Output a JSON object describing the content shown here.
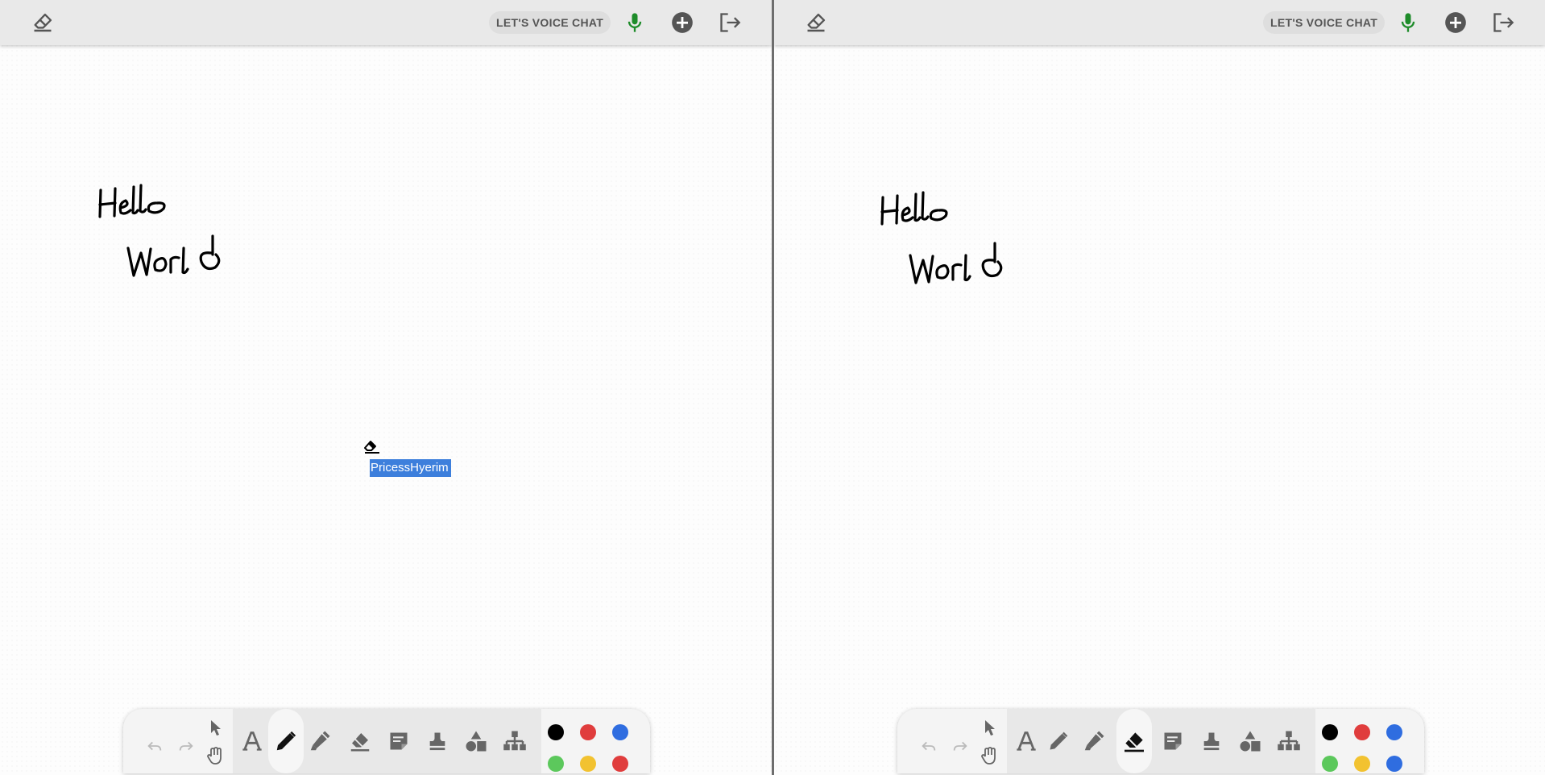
{
  "topbar": {
    "voice_chat_label": "LET'S VOICE CHAT",
    "icons": [
      "eraser-icon",
      "microphone-icon",
      "add-circle-icon",
      "logout-icon"
    ]
  },
  "colors": {
    "mic": "#1e8c2a",
    "selection": "#3d7fdc",
    "palette": [
      "#000000",
      "#e03d3d",
      "#2f6de0",
      "#5cc85c",
      "#f2c230",
      "#e03d3d",
      "#000000",
      "#e03d3d",
      "#2f6de0",
      "#5cc85c",
      "#f2c230",
      "#2f6de0"
    ]
  },
  "canvas": {
    "handwriting_line1": "Hello",
    "handwriting_line2": "World",
    "cursor_user_label": "PricessHyerim"
  },
  "toolbar": {
    "tools": [
      "undo-icon",
      "redo-icon",
      "select-pointer-icon",
      "hand-pan-icon",
      "text-icon",
      "pen-icon",
      "highlighter-icon",
      "eraser-icon",
      "sticky-note-icon",
      "stamp-icon",
      "shapes-icon",
      "org-chart-icon"
    ],
    "left_active_tool": "pen",
    "right_active_tool": "eraser"
  }
}
